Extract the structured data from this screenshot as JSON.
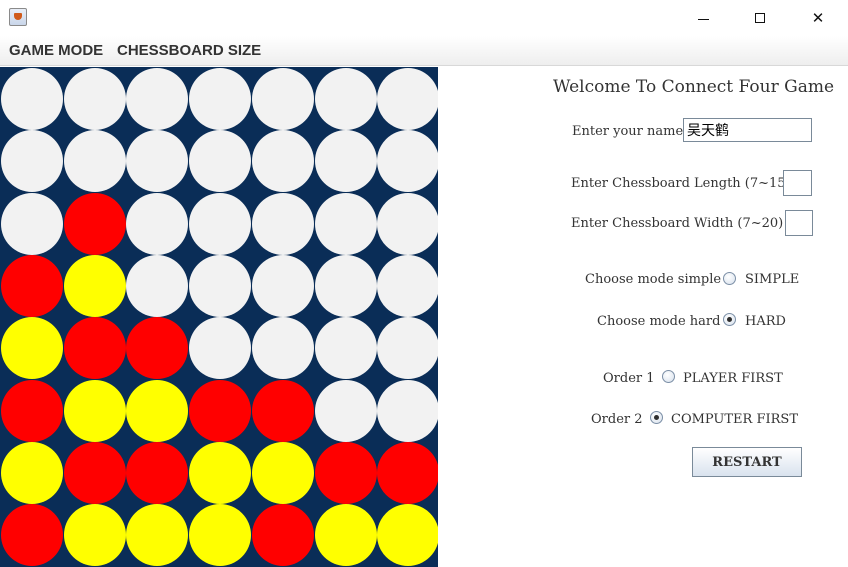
{
  "window": {
    "close_glyph": "✕"
  },
  "menu": {
    "game_mode": "GAME MODE",
    "chessboard_size": "CHESSBOARD SIZE"
  },
  "board": {
    "colors": {
      "board": "#0a2d57",
      "empty": "#f2f2f2",
      "red": "#ff0000",
      "yellow": "#ffff00"
    },
    "rows": [
      [
        "empty",
        "empty",
        "empty",
        "empty",
        "empty",
        "empty",
        "empty"
      ],
      [
        "empty",
        "empty",
        "empty",
        "empty",
        "empty",
        "empty",
        "empty"
      ],
      [
        "empty",
        "red",
        "empty",
        "empty",
        "empty",
        "empty",
        "empty"
      ],
      [
        "red",
        "yellow",
        "empty",
        "empty",
        "empty",
        "empty",
        "empty"
      ],
      [
        "yellow",
        "red",
        "red",
        "empty",
        "empty",
        "empty",
        "empty"
      ],
      [
        "red",
        "yellow",
        "yellow",
        "red",
        "red",
        "empty",
        "empty"
      ],
      [
        "yellow",
        "red",
        "red",
        "yellow",
        "yellow",
        "red",
        "red"
      ],
      [
        "red",
        "yellow",
        "yellow",
        "yellow",
        "red",
        "yellow",
        "yellow"
      ]
    ]
  },
  "panel": {
    "title": "Welcome To Connect Four Game",
    "name_label": "Enter your name",
    "name_value": "吴天鹤",
    "length_label": "Enter Chessboard Length (7~15)",
    "length_value": "",
    "width_label": "Enter Chessboard Width   (7~20)",
    "width_value": "",
    "mode_simple_label": "Choose mode simple",
    "mode_simple_option": "SIMPLE",
    "mode_hard_label": "Choose mode hard",
    "mode_hard_option": "HARD",
    "order1_label": "Order 1",
    "order1_option": "PLAYER FIRST",
    "order2_label": "Order 2",
    "order2_option": "COMPUTER FIRST",
    "restart_label": "RESTART",
    "selected_mode": "HARD",
    "selected_order": "COMPUTER FIRST"
  }
}
